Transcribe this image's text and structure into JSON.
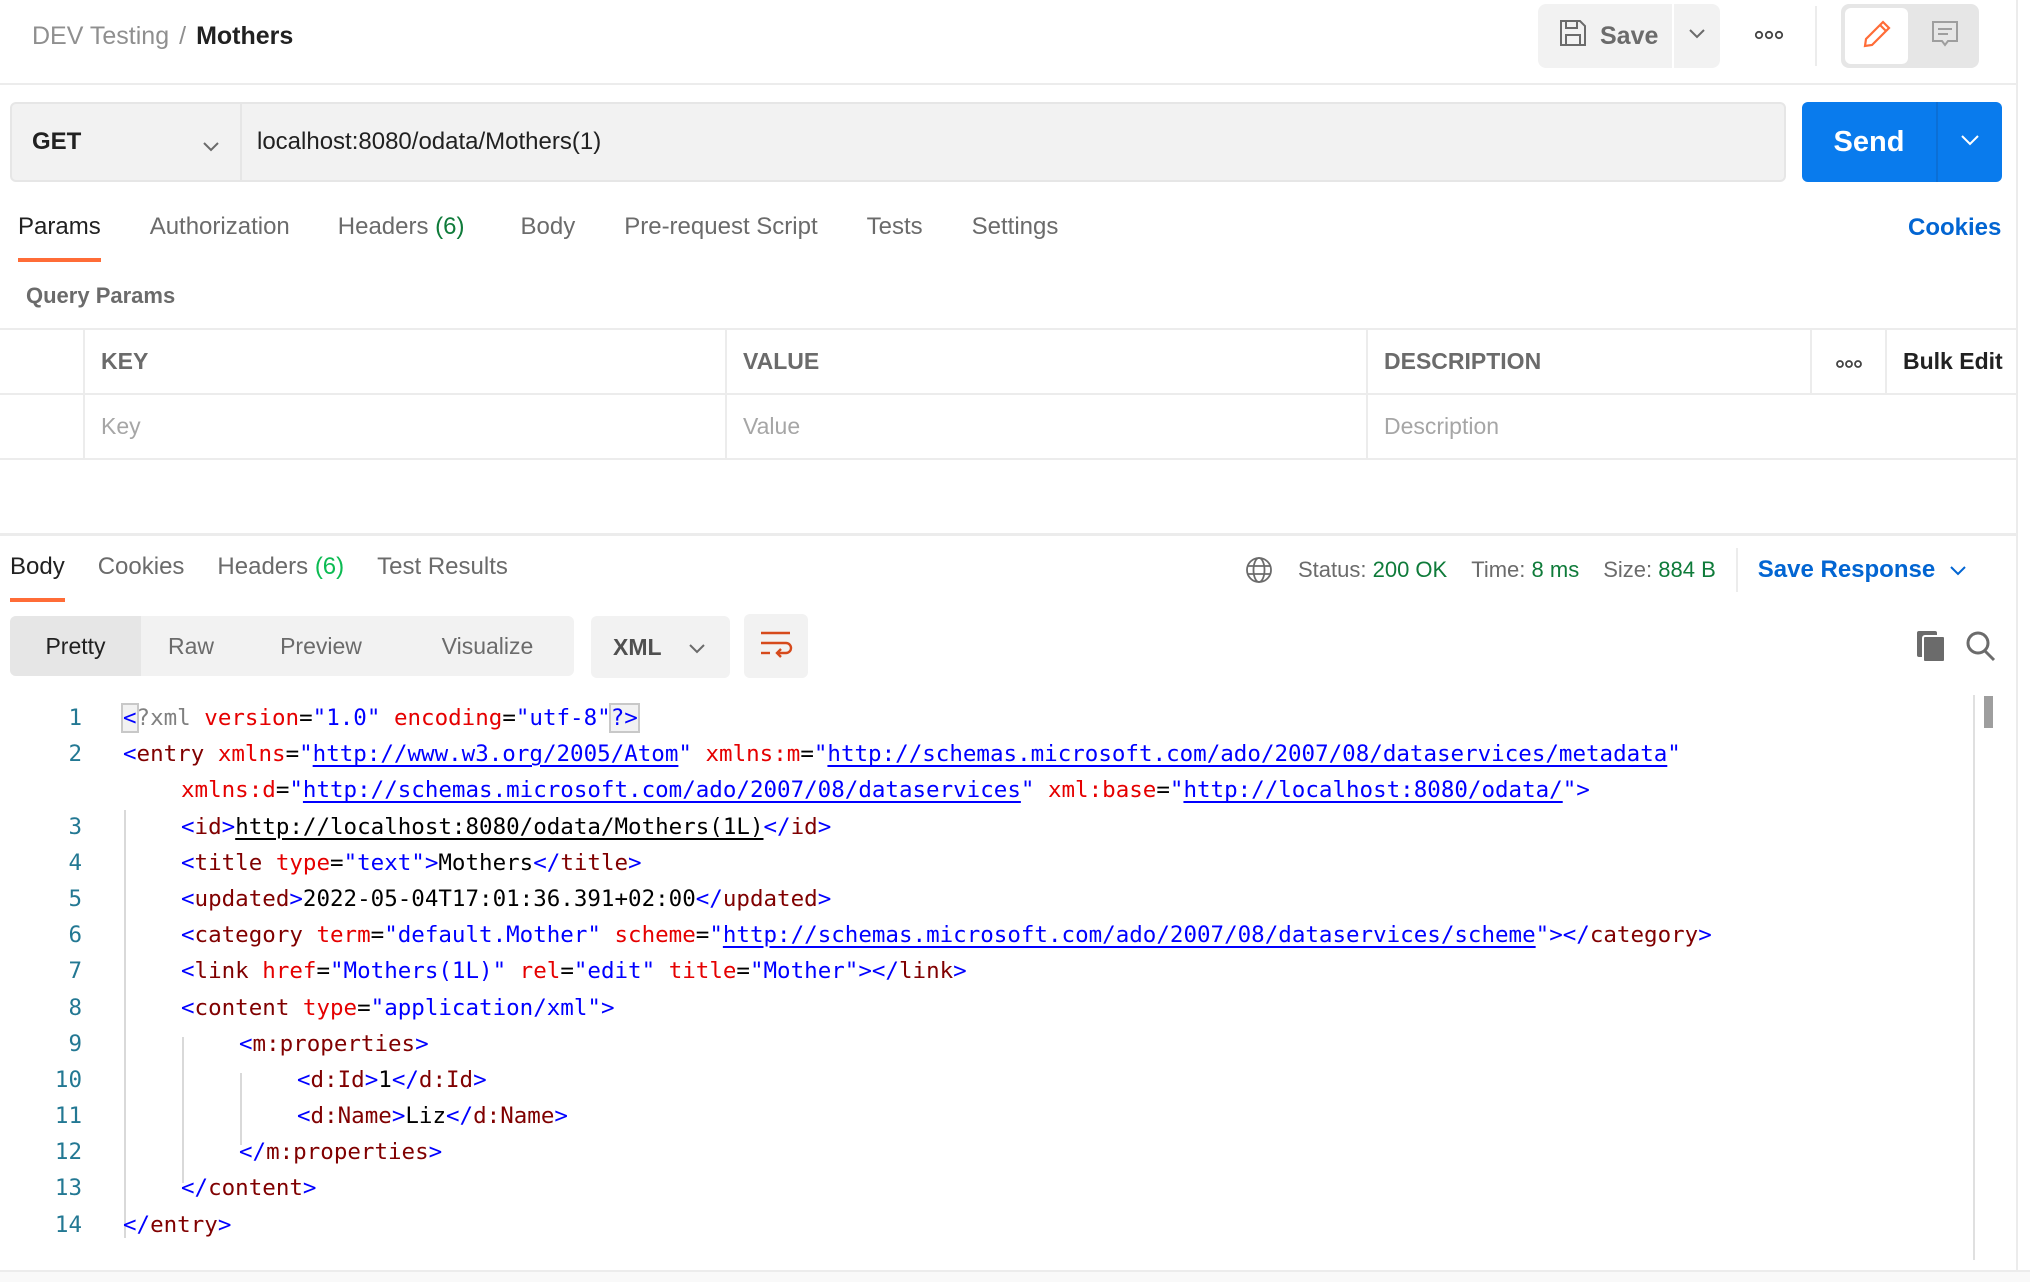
{
  "header": {
    "breadcrumb_parent": "DEV Testing",
    "breadcrumb_separator": "/",
    "breadcrumb_current": "Mothers",
    "save_label": "Save",
    "icons": [
      "save-icon",
      "chevron-down-icon",
      "more-horizontal-icon",
      "pencil-icon",
      "comment-icon"
    ]
  },
  "request": {
    "method": "GET",
    "url": "localhost:8080/odata/Mothers(1)",
    "send_label": "Send",
    "tabs": [
      {
        "label": "Params",
        "active": true
      },
      {
        "label": "Authorization"
      },
      {
        "label": "Headers",
        "count": "(6)"
      },
      {
        "label": "Body"
      },
      {
        "label": "Pre-request Script"
      },
      {
        "label": "Tests"
      },
      {
        "label": "Settings"
      }
    ],
    "cookies_label": "Cookies",
    "query_params_label": "Query Params",
    "table": {
      "columns": [
        "KEY",
        "VALUE",
        "DESCRIPTION"
      ],
      "bulk_edit_label": "Bulk Edit",
      "placeholders": {
        "key": "Key",
        "value": "Value",
        "description": "Description"
      }
    }
  },
  "response": {
    "tabs": [
      {
        "label": "Body",
        "active": true
      },
      {
        "label": "Cookies"
      },
      {
        "label": "Headers",
        "count": "(6)"
      },
      {
        "label": "Test Results"
      }
    ],
    "status_label": "Status:",
    "status_value": "200 OK",
    "time_label": "Time:",
    "time_value": "8 ms",
    "size_label": "Size:",
    "size_value": "884 B",
    "save_response_label": "Save Response",
    "views": [
      "Pretty",
      "Raw",
      "Preview",
      "Visualize"
    ],
    "active_view": "Pretty",
    "format": "XML",
    "accent_color": "#ff6c37",
    "send_color": "#097bed",
    "status_color": "#0f7b3a",
    "code_lines": [
      "1",
      "2",
      "",
      "3",
      "4",
      "5",
      "6",
      "7",
      "8",
      "9",
      "10",
      "11",
      "12",
      "13",
      "14"
    ],
    "code": {
      "l1": {
        "open": "<",
        "pi": "?xml",
        "a1": "version",
        "v1": "\"1.0\"",
        "a2": "encoding",
        "v2": "\"utf-8\"",
        "close": "?>"
      },
      "l2": {
        "tag": "entry",
        "a1": "xmlns",
        "u1": "http://www.w3.org/2005/Atom",
        "a2": "xmlns:m",
        "u2": "http://schemas.microsoft.com/ado/2007/08/dataservices/metadata"
      },
      "l2b": {
        "a3": "xmlns:d",
        "u3": "http://schemas.microsoft.com/ado/2007/08/dataservices",
        "a4": "xml:base",
        "u4": "http://localhost:8080/odata/"
      },
      "l3": {
        "tag": "id",
        "text": "http://localhost:8080/odata/Mothers(1L)"
      },
      "l4": {
        "tag": "title",
        "a1": "type",
        "v1": "\"text\"",
        "text": "Mothers"
      },
      "l5": {
        "tag": "updated",
        "text": "2022-05-04T17:01:36.391+02:00"
      },
      "l6": {
        "tag": "category",
        "a1": "term",
        "v1": "\"default.Mother\"",
        "a2": "scheme",
        "u2": "http://schemas.microsoft.com/ado/2007/08/dataservices/scheme"
      },
      "l7": {
        "tag": "link",
        "a1": "href",
        "v1": "\"Mothers(1L)\"",
        "a2": "rel",
        "v2": "\"edit\"",
        "a3": "title",
        "v3": "\"Mother\""
      },
      "l8": {
        "tag": "content",
        "a1": "type",
        "v1": "\"application/xml\""
      },
      "l9": {
        "tag": "m:properties"
      },
      "l10": {
        "tag": "d:Id",
        "text": "1"
      },
      "l11": {
        "tag": "d:Name",
        "text": "Liz"
      },
      "l12": {
        "tag": "m:properties"
      },
      "l13": {
        "tag": "content"
      },
      "l14": {
        "tag": "entry"
      }
    }
  }
}
